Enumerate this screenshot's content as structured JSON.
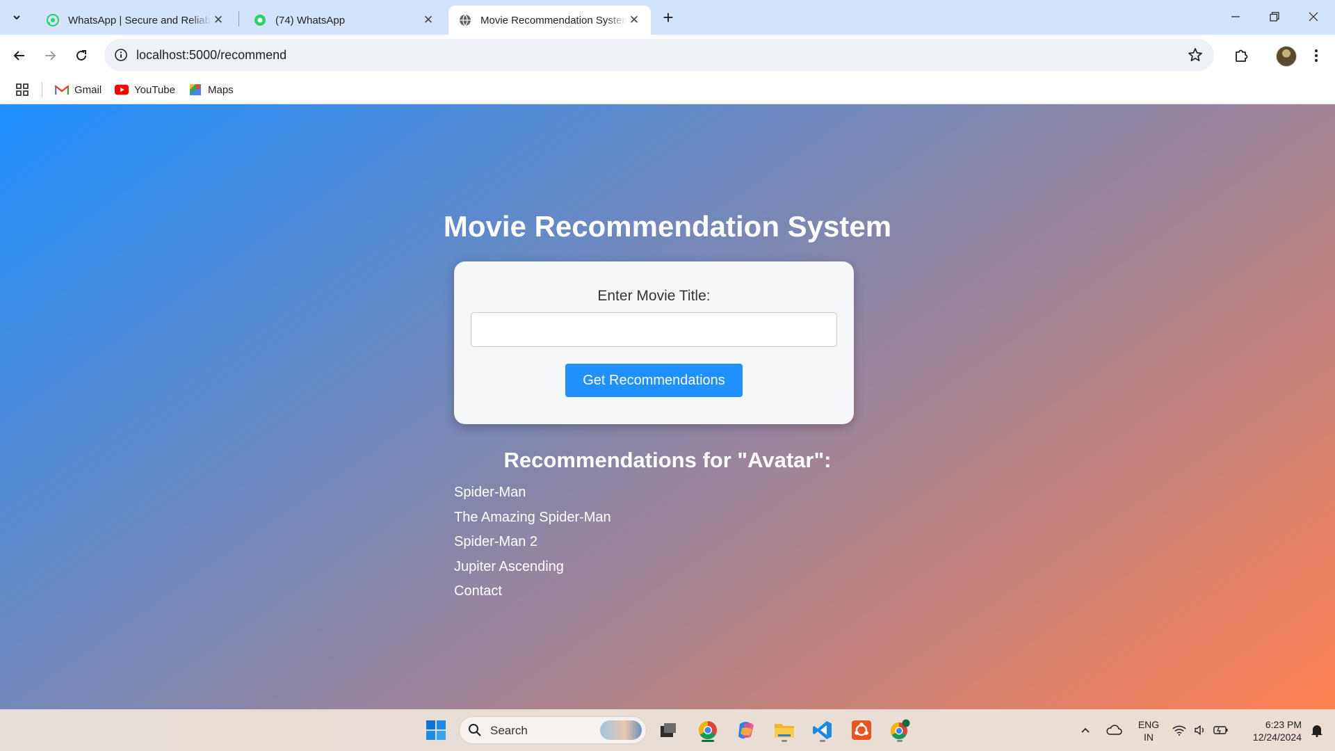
{
  "browser": {
    "tabs": [
      {
        "title": "WhatsApp | Secure and Reliable",
        "favicon": "whatsapp-icon",
        "active": false
      },
      {
        "title": "(74) WhatsApp",
        "favicon": "whatsapp-icon",
        "active": false
      },
      {
        "title": "Movie Recommendation System",
        "favicon": "globe-icon",
        "active": true
      }
    ],
    "url": "localhost:5000/recommend",
    "bookmarks": [
      {
        "label": "Gmail",
        "icon": "gmail-icon"
      },
      {
        "label": "YouTube",
        "icon": "youtube-icon"
      },
      {
        "label": "Maps",
        "icon": "maps-icon"
      }
    ]
  },
  "page": {
    "title": "Movie Recommendation System",
    "form": {
      "label": "Enter Movie Title:",
      "input_value": "",
      "input_placeholder": "",
      "button_label": "Get Recommendations"
    },
    "recommendations": {
      "heading": "Recommendations for \"Avatar\":",
      "items": [
        "Spider-Man",
        "The Amazing Spider-Man",
        "Spider-Man 2",
        "Jupiter Ascending",
        "Contact"
      ]
    }
  },
  "taskbar": {
    "search_label": "Search",
    "language": {
      "line1": "ENG",
      "line2": "IN"
    },
    "time": "6:23 PM",
    "date": "12/24/2024"
  },
  "colors": {
    "tab_strip": "#d3e3fd",
    "accent_button": "#1e90ff",
    "gradient_start": "#1e90ff",
    "gradient_end": "#ff7f50"
  }
}
